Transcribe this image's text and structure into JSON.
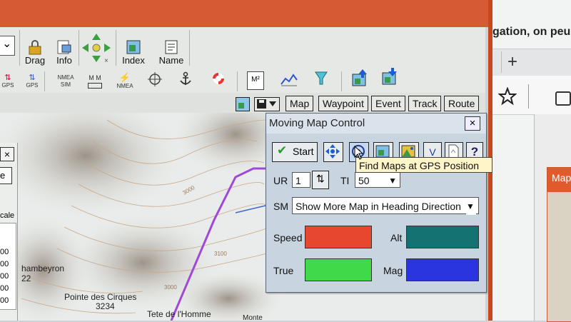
{
  "browser": {
    "page_text": "gation, on peu",
    "new_tab_symbol": "+",
    "favorite_icon": "star-icon",
    "more_icon": "ellipsis-icon",
    "side_tab_label": "Map"
  },
  "toolbar": {
    "dropdown_arrow": "⌄",
    "drag_label": "Drag",
    "info_label": "Info",
    "index_label": "Index",
    "name_label": "Name",
    "gps_label_1": "GPS",
    "gps_label_2": "GPS",
    "nmea_sim": "NMEA SIM",
    "mm_label": "M M",
    "nmea_label": "NMEA"
  },
  "tabs": {
    "map": "Map",
    "waypoint": "Waypoint",
    "event": "Event",
    "track": "Track",
    "route": "Route"
  },
  "left_panel": {
    "close_symbol": "×",
    "fragment_e": "e",
    "scale_fragment": "cale",
    "values": [
      "00",
      "00",
      "00",
      "00",
      "00"
    ]
  },
  "map_labels": {
    "chambeyron": "hambeyron",
    "chambeyron_alt": "22",
    "pointe_des_cirques": "Pointe des Cirques",
    "pointe_alt": "3234",
    "tete_homme": "Tete de l'Homme",
    "monte": "Monte",
    "contour_1": "3000",
    "contour_2": "3100",
    "contour_3": "3000"
  },
  "dialog": {
    "title": "Moving Map Control",
    "close_symbol": "×",
    "start_label": "Start",
    "v_label": "V",
    "help_label": "?",
    "ur_label": "UR",
    "ur_value": "1",
    "ti_label": "TI",
    "ti_value": "50",
    "sm_label": "SM",
    "sm_value": "Show More Map in Heading Direction",
    "speed_label": "Speed",
    "alt_label": "Alt",
    "true_label": "True",
    "mag_label": "Mag",
    "colors": {
      "speed": "#e8472f",
      "alt": "#157272",
      "true": "#3fd94a",
      "mag": "#2a35e0"
    }
  },
  "tooltip": {
    "text": "Find Maps at GPS Position"
  }
}
